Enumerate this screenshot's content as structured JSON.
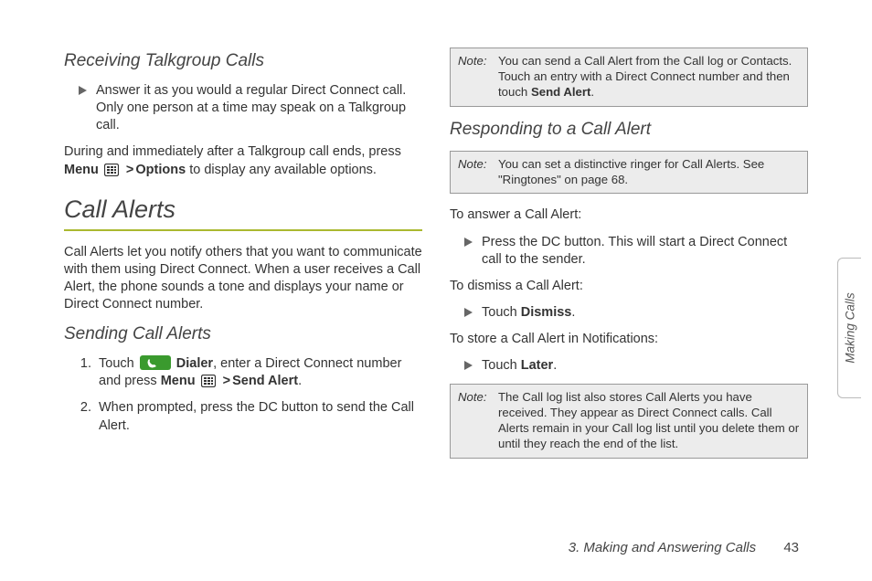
{
  "left": {
    "h_receiving": "Receiving Talkgroup Calls",
    "receiving_bullet": "Answer it as you would a regular Direct Connect call. Only one person at a time may speak on a Talkgroup call.",
    "receiving_after_1": "During and immediately after a Talkgroup call ends, press ",
    "receiving_menu": "Menu",
    "receiving_options": "Options",
    "receiving_after_2": " to display any available options.",
    "h_call_alerts": "Call Alerts",
    "call_alerts_intro": "Call Alerts let you notify others that you want to communicate with them using Direct Connect. When a user receives a Call Alert, the phone sounds a tone and displays your name or Direct Connect number.",
    "h_sending": "Sending Call Alerts",
    "send_step1_a": "Touch ",
    "send_step1_dialer": "Dialer",
    "send_step1_b": ", enter a Direct Connect number and press ",
    "send_step1_menu": "Menu",
    "send_step1_sendalert": "Send Alert",
    "send_step1_end": ".",
    "send_step2": "When prompted, press the DC button to send the Call Alert."
  },
  "right": {
    "note1_label": "Note:",
    "note1_a": "You can send a Call Alert from the Call log or Contacts. Touch an entry with a Direct Connect number and then touch ",
    "note1_bold": "Send Alert",
    "note1_end": ".",
    "h_responding": "Responding to a Call Alert",
    "note2_label": "Note:",
    "note2_text": "You can set a distinctive ringer for Call Alerts. See \"Ringtones\" on page 68.",
    "answer_intro": "To answer a Call Alert:",
    "answer_bullet": "Press the DC button. This will start a Direct Connect call to the sender.",
    "dismiss_intro": "To dismiss a Call Alert:",
    "dismiss_touch": "Touch ",
    "dismiss_bold": "Dismiss",
    "dismiss_end": ".",
    "store_intro": "To store a Call Alert in Notifications:",
    "store_touch": "Touch ",
    "store_bold": "Later",
    "store_end": ".",
    "note3_label": "Note:",
    "note3_text": "The Call log list also stores Call Alerts you have received. They appear as Direct Connect calls. Call Alerts remain in your Call log list until you delete them or until they reach the end of the list."
  },
  "sidetab": "Making Calls",
  "footer_chapter": "3. Making and Answering Calls",
  "footer_page": "43"
}
